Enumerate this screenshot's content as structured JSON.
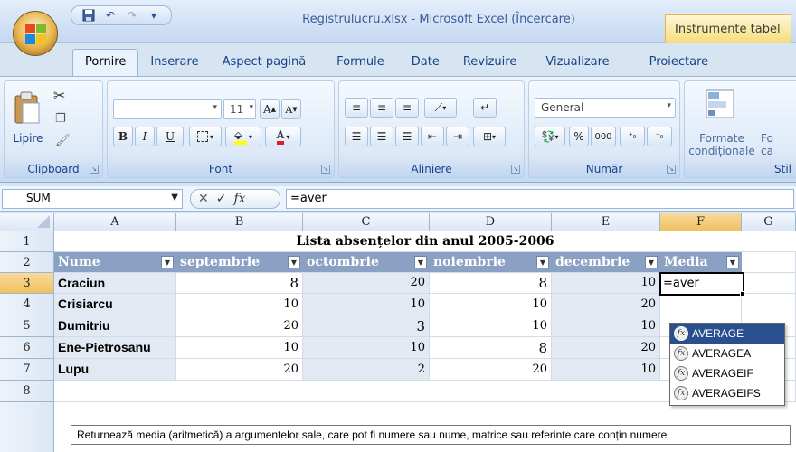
{
  "app": {
    "title": "Registrulucru.xlsx - Microsoft Excel (Încercare)",
    "context_tab": "Instrumente tabel"
  },
  "qat": {
    "dropdown": "▾"
  },
  "tabs": [
    "Pornire",
    "Inserare",
    "Aspect pagină",
    "Formule",
    "Date",
    "Revizuire",
    "Vizualizare",
    "Proiectare"
  ],
  "ribbon": {
    "clipboard": {
      "label": "Clipboard",
      "paste_label": "Lipire"
    },
    "font": {
      "label": "Font",
      "size": "11",
      "bold": "B",
      "italic": "I",
      "underline": "U"
    },
    "alignment": {
      "label": "Aliniere"
    },
    "number": {
      "label": "Număr",
      "format": "General",
      "percent": "%",
      "thousands": "000"
    },
    "styles": {
      "label": "Stil",
      "conditional_line1": "Formate",
      "conditional_line2": "condiționale",
      "next_line1": "Fo",
      "next_line2": "ca"
    }
  },
  "formula_bar": {
    "name_box": "SUM",
    "cancel": "✕",
    "enter": "✓",
    "fx": "fx",
    "value": "=aver"
  },
  "columns": [
    "A",
    "B",
    "C",
    "D",
    "E",
    "F",
    "G"
  ],
  "rows": [
    "1",
    "2",
    "3",
    "4",
    "5",
    "6",
    "7",
    "8"
  ],
  "sheet": {
    "title": "Lista absențelor din anul 2005-2006",
    "headers": [
      "Nume",
      "septembrie",
      "octombrie",
      "noiembrie",
      "decembrie",
      "Media"
    ],
    "data": [
      [
        "Craciun",
        "8",
        "20",
        "8",
        "10"
      ],
      [
        "Crisiarcu",
        "10",
        "10",
        "10",
        "20"
      ],
      [
        "Dumitriu",
        "20",
        "3",
        "10",
        "10"
      ],
      [
        "Ene-Pietrosanu",
        "10",
        "10",
        "8",
        "20"
      ],
      [
        "Lupu",
        "20",
        "2",
        "20",
        "10"
      ]
    ],
    "active_cell_value": "=aver"
  },
  "autocomplete": {
    "icon": "fx",
    "items": [
      "AVERAGE",
      "AVERAGEA",
      "AVERAGEIF",
      "AVERAGEIFS"
    ]
  },
  "tooltip": "Returnează media (aritmetică) a argumentelor sale, care pot fi numere sau nume, matrice sau referințe care conțin numere"
}
